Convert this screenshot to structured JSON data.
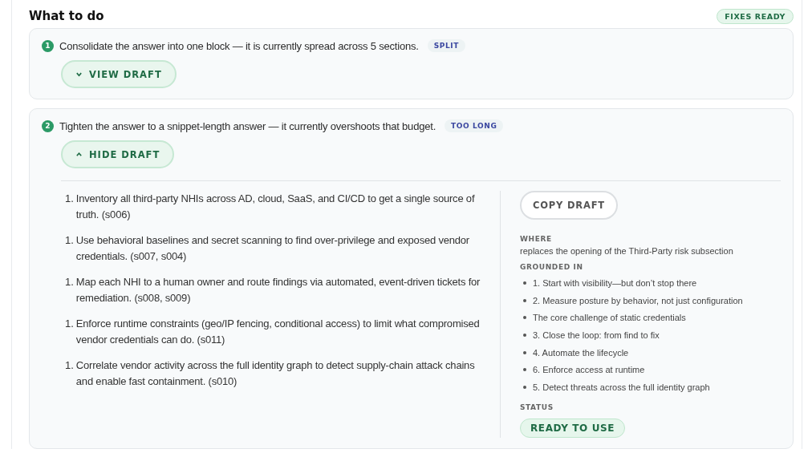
{
  "title": "What to do",
  "status_badge": "FIXES READY",
  "fixes": [
    {
      "number": "1",
      "text": "Consolidate the answer into one block — it is currently spread across 5 sections.",
      "tag": "SPLIT",
      "toggle": "VIEW DRAFT",
      "expanded": false
    },
    {
      "number": "2",
      "text": "Tighten the answer to a snippet-length answer — it currently overshoots that budget.",
      "tag": "TOO LONG",
      "toggle": "HIDE DRAFT",
      "expanded": true,
      "draft": {
        "items": [
          {
            "marker": "1.",
            "text": "Inventory all third-party NHIs across AD, cloud, SaaS, and CI/CD to get a single source of truth. (s006)"
          },
          {
            "marker": "1.",
            "text": "Use behavioral baselines and secret scanning to find over-privilege and exposed vendor credentials. (s007, s004)"
          },
          {
            "marker": "1.",
            "text": "Map each NHI to a human owner and route findings via automated, event-driven tickets for remediation. (s008, s009)"
          },
          {
            "marker": "1.",
            "text": "Enforce runtime constraints (geo/IP fencing, conditional access) to limit what compromised vendor credentials can do. (s011)"
          },
          {
            "marker": "1.",
            "text": "Correlate vendor activity across the full identity graph to detect supply-chain attack chains and enable fast containment. (s010)"
          }
        ],
        "copy_button": "COPY DRAFT",
        "where_label": "WHERE",
        "where": "replaces the opening of the Third-Party risk subsection",
        "grounded_label": "GROUNDED IN",
        "grounded": [
          "1. Start with visibility—but don’t stop there",
          "2. Measure posture by behavior, not just configuration",
          "The core challenge of static credentials",
          "3. Close the loop: from find to fix",
          "4. Automate the lifecycle",
          "6. Enforce access at runtime",
          "5. Detect threats across the full identity graph"
        ],
        "status_label": "STATUS",
        "status": "READY TO USE"
      }
    }
  ]
}
